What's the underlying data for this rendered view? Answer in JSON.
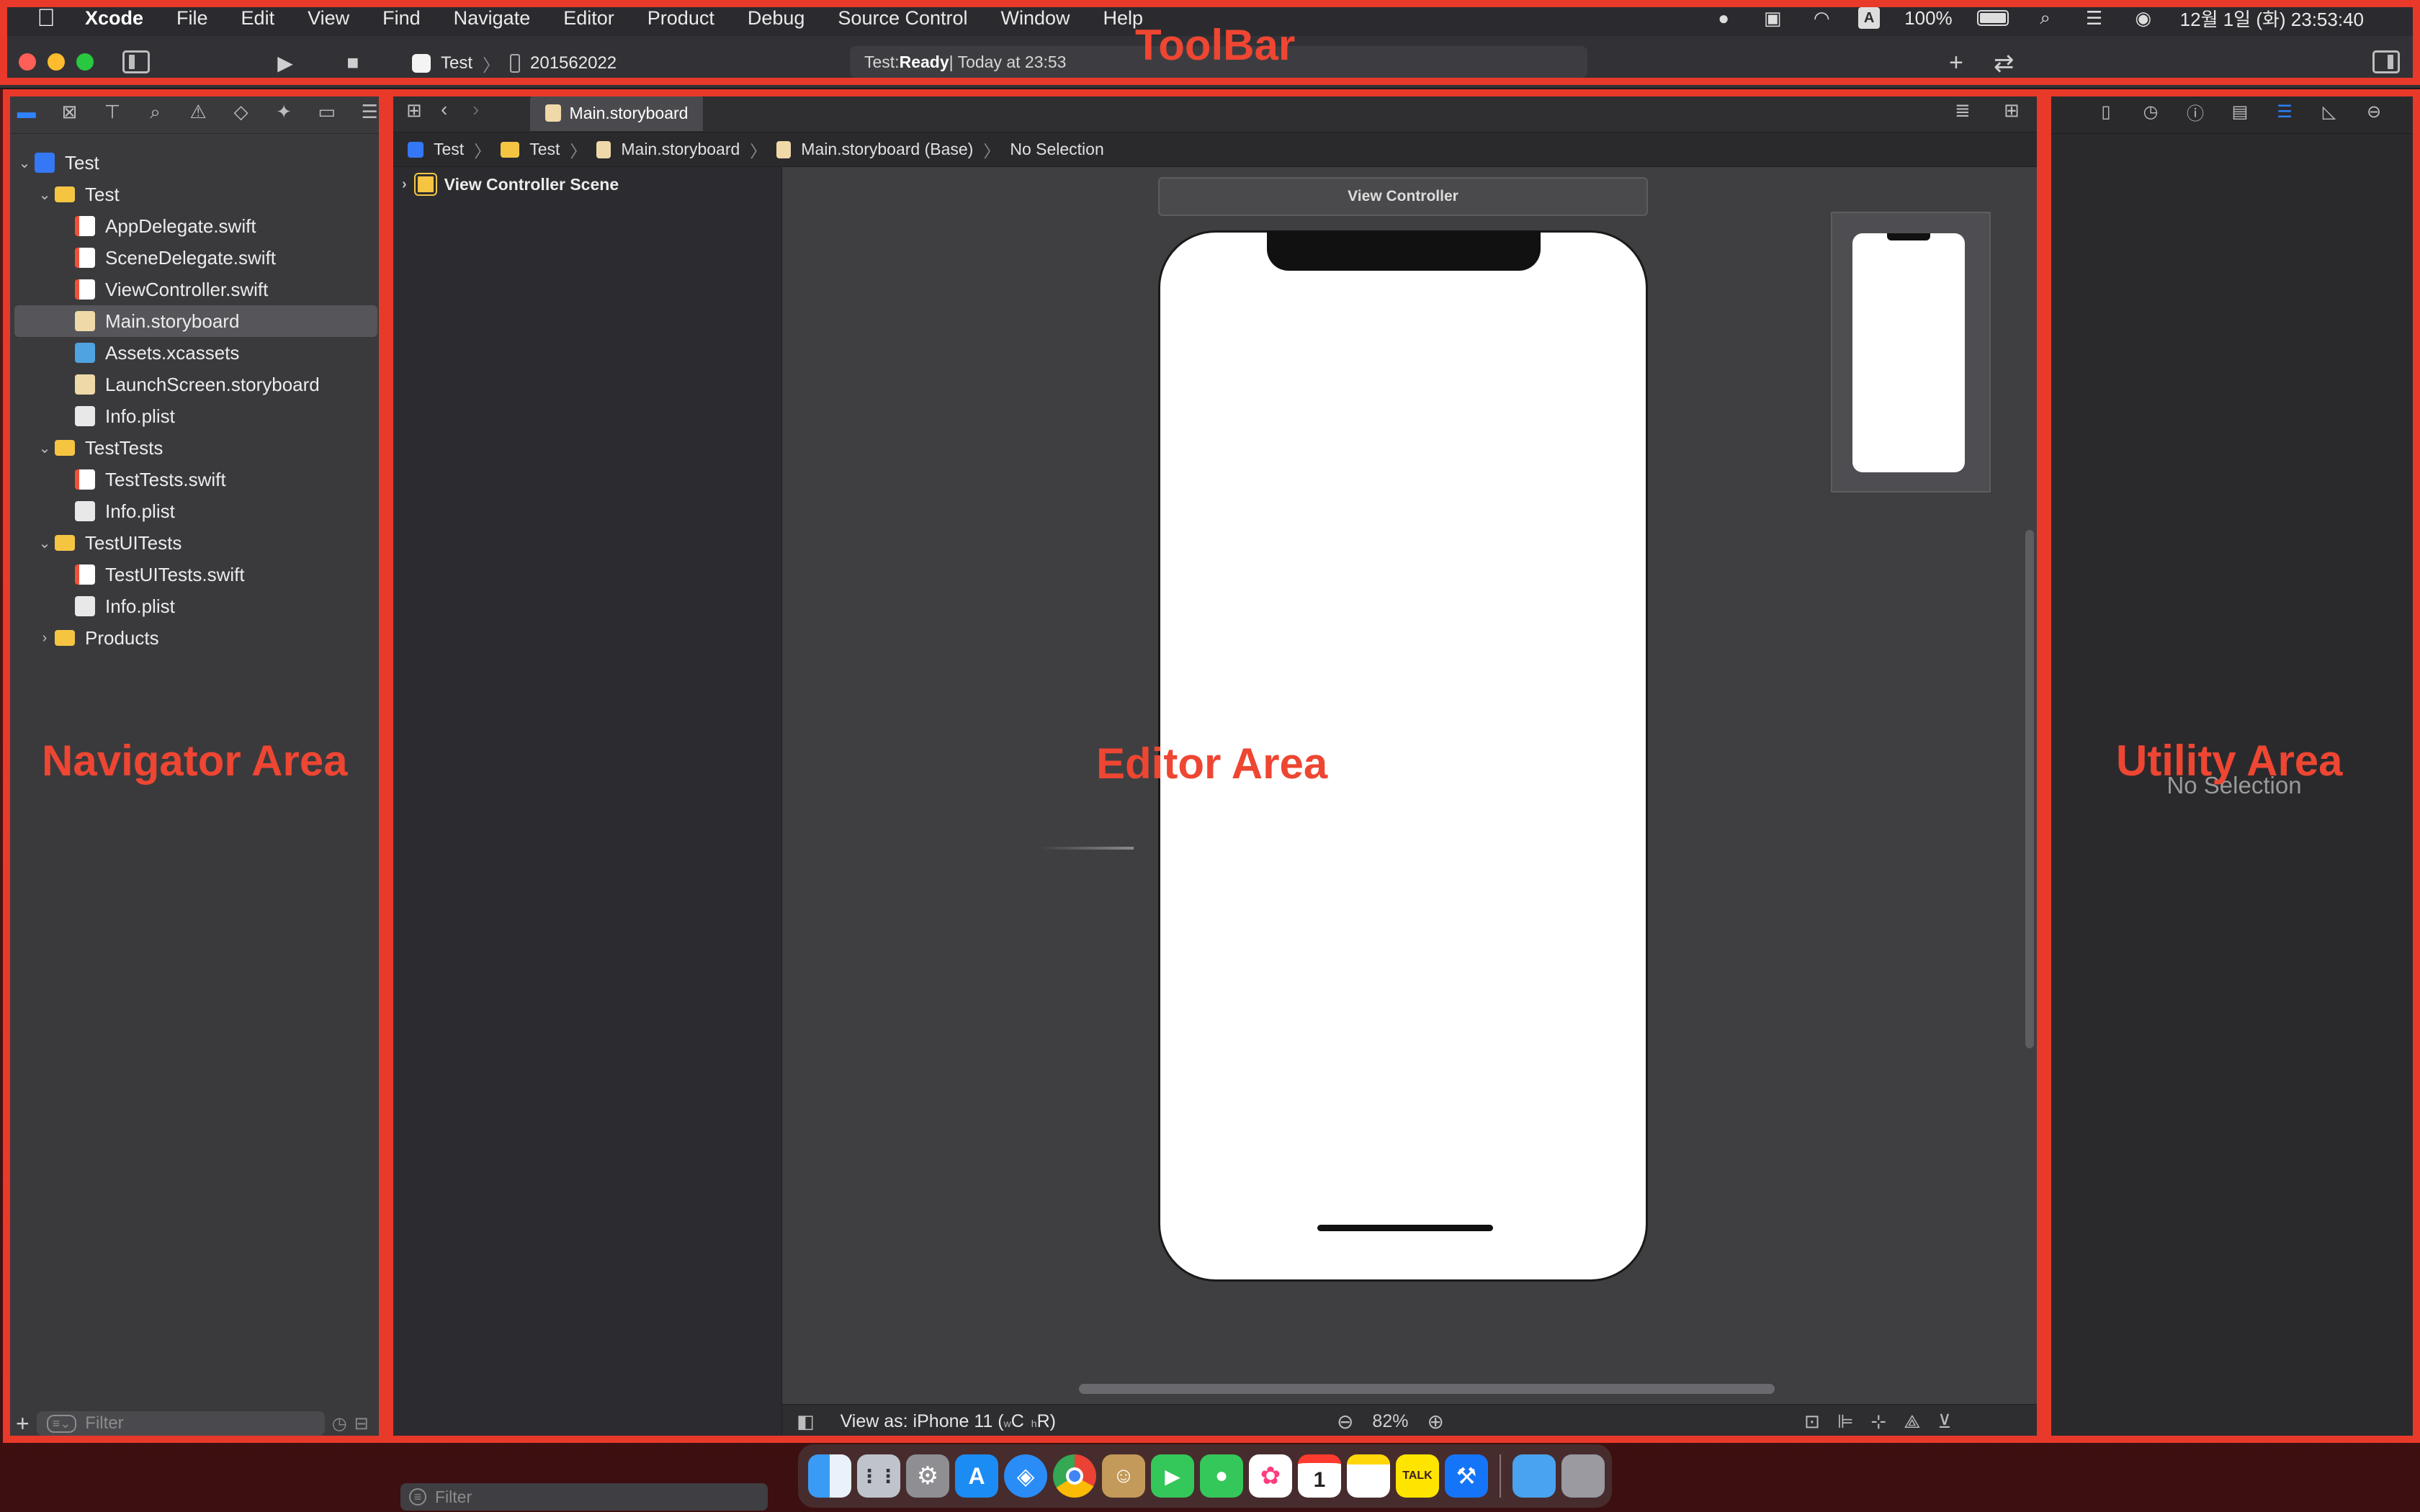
{
  "menubar": {
    "apple": "",
    "items": [
      "Xcode",
      "File",
      "Edit",
      "View",
      "Find",
      "Navigate",
      "Editor",
      "Product",
      "Debug",
      "Source Control",
      "Window",
      "Help"
    ],
    "battery": "100%",
    "clock": "12월 1일 (화)  23:53:40"
  },
  "toolbar": {
    "scheme": "Test",
    "device": "201562022",
    "status_project": "Test: ",
    "status_state": "Ready",
    "status_time": " | Today at 23:53"
  },
  "navigator": {
    "tree": [
      {
        "label": "Test",
        "type": "project",
        "level": 0,
        "expanded": true
      },
      {
        "label": "Test",
        "type": "folder",
        "level": 1,
        "expanded": true
      },
      {
        "label": "AppDelegate.swift",
        "type": "swift",
        "level": 2
      },
      {
        "label": "SceneDelegate.swift",
        "type": "swift",
        "level": 2
      },
      {
        "label": "ViewController.swift",
        "type": "swift",
        "level": 2
      },
      {
        "label": "Main.storyboard",
        "type": "storyboard",
        "level": 2,
        "selected": true
      },
      {
        "label": "Assets.xcassets",
        "type": "assets",
        "level": 2
      },
      {
        "label": "LaunchScreen.storyboard",
        "type": "storyboard",
        "level": 2
      },
      {
        "label": "Info.plist",
        "type": "plist",
        "level": 2
      },
      {
        "label": "TestTests",
        "type": "folder",
        "level": 1,
        "expanded": true
      },
      {
        "label": "TestTests.swift",
        "type": "swift",
        "level": 2
      },
      {
        "label": "Info.plist",
        "type": "plist",
        "level": 2
      },
      {
        "label": "TestUITests",
        "type": "folder",
        "level": 1,
        "expanded": true
      },
      {
        "label": "TestUITests.swift",
        "type": "swift",
        "level": 2
      },
      {
        "label": "Info.plist",
        "type": "plist",
        "level": 2
      },
      {
        "label": "Products",
        "type": "folder",
        "level": 1,
        "expanded": false
      }
    ],
    "filter_placeholder": "Filter"
  },
  "editor": {
    "tab": "Main.storyboard",
    "breadcrumb": [
      "Test",
      "Test",
      "Main.storyboard",
      "Main.storyboard (Base)",
      "No Selection"
    ],
    "scene": "View Controller Scene",
    "vc_title": "View Controller",
    "view_as": "View as: iPhone 11 (",
    "size_class_w": "w",
    "size_class_c": "C",
    "size_class_h": "h",
    "size_class_r": "R)",
    "zoom": "82%",
    "outline_filter_placeholder": "Filter"
  },
  "utility": {
    "no_selection": "No Selection"
  },
  "overlays": {
    "toolbar": "ToolBar",
    "navigator": "Navigator Area",
    "editor": "Editor Area",
    "utility": "Utility Area"
  },
  "dock": {
    "apps": [
      "finder",
      "launchpad",
      "system-preferences",
      "app-store",
      "safari",
      "chrome",
      "contacts",
      "facetime",
      "messages",
      "photos",
      "calendar",
      "notes",
      "kakaotalk",
      "xcode",
      "downloads-folder",
      "trash"
    ],
    "calendar_day": "1",
    "kakaotalk_label": "TALK"
  },
  "colors": {
    "accent": "#2f83ff",
    "overlay": "#e8392a",
    "traffic_red": "#fe5f57",
    "traffic_yellow": "#febc2e",
    "traffic_green": "#28c840"
  }
}
